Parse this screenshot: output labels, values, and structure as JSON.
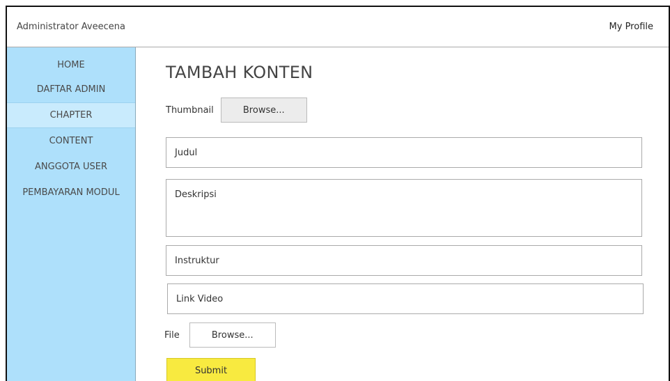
{
  "header": {
    "brand": "Administrator Aveecena",
    "profile_link": "My Profile"
  },
  "sidebar": {
    "items": [
      {
        "label": "HOME"
      },
      {
        "label": "DAFTAR ADMIN"
      },
      {
        "label": "CHAPTER",
        "active": true
      },
      {
        "label": "CONTENT"
      },
      {
        "label": "ANGGOTA USER"
      },
      {
        "label": "PEMBAYARAN MODUL"
      }
    ]
  },
  "main": {
    "title": "TAMBAH KONTEN",
    "thumbnail": {
      "label": "Thumbnail",
      "button": "Browse..."
    },
    "fields": {
      "judul": "Judul",
      "deskripsi": "Deskripsi",
      "instruktur": "Instruktur",
      "link_video": "Link Video"
    },
    "file": {
      "label": "File",
      "button": "Browse..."
    },
    "submit_label": "Submit"
  },
  "colors": {
    "sidebar_bg": "#aee0fb",
    "sidebar_active": "#c9ebfd",
    "submit_bg": "#f8ea40"
  }
}
